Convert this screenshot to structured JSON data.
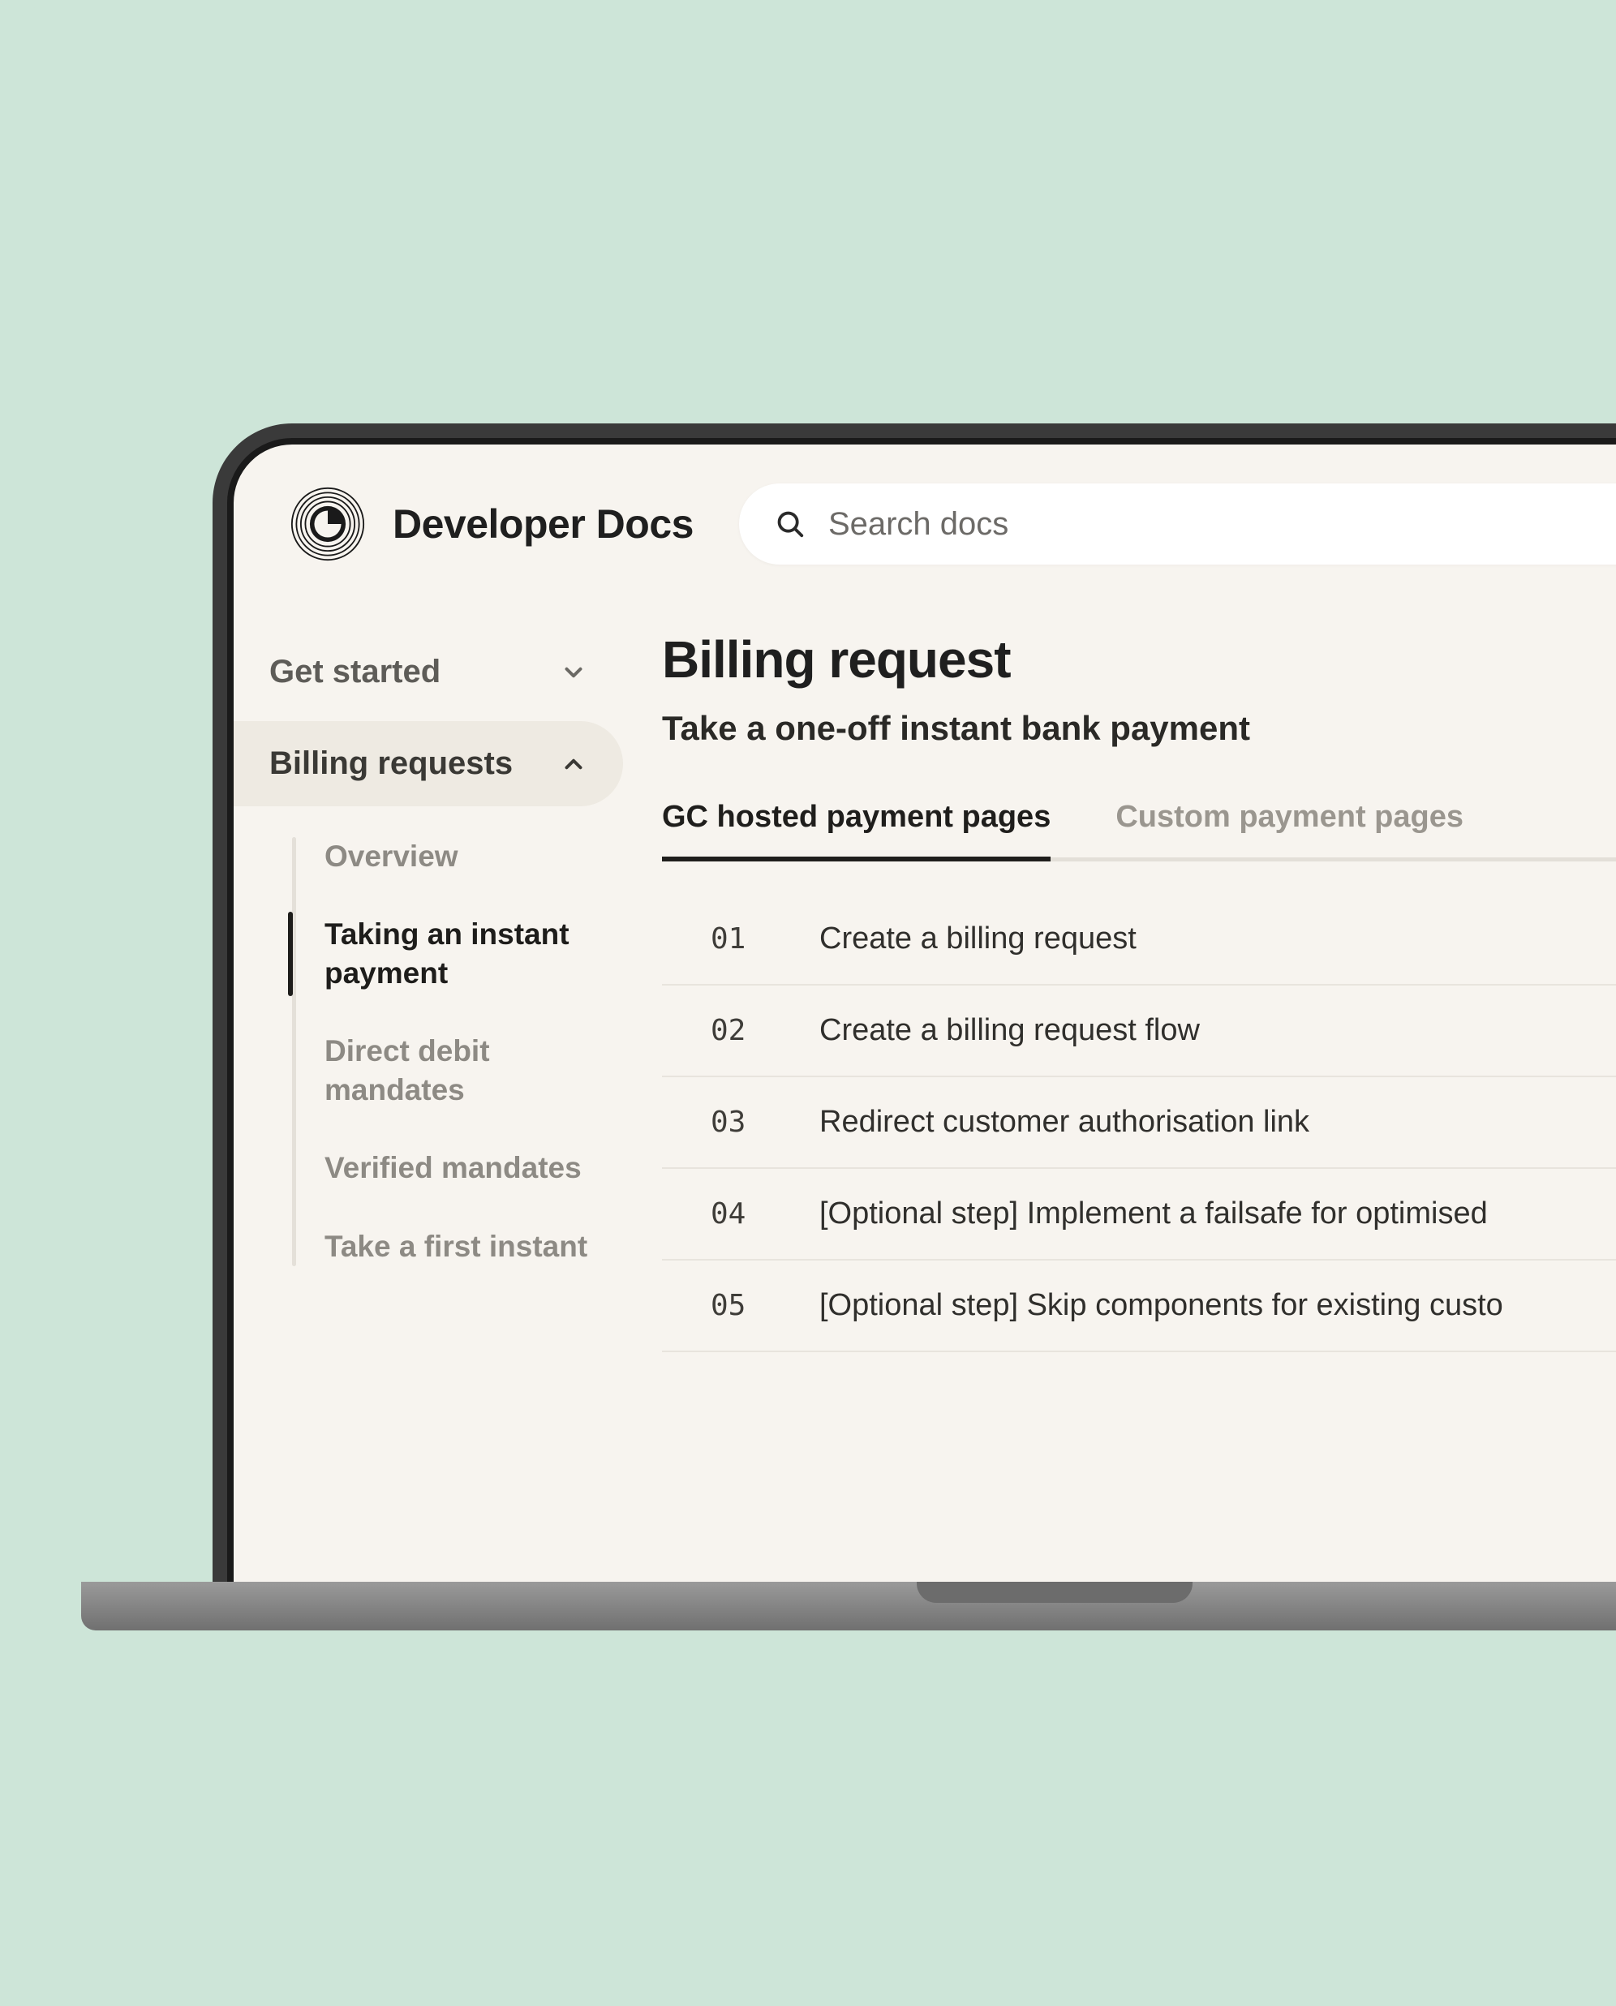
{
  "header": {
    "brand": "Developer Docs",
    "search_placeholder": "Search docs"
  },
  "sidebar": {
    "top": [
      {
        "label": "Get started",
        "expanded": false
      },
      {
        "label": "Billing requests",
        "expanded": true
      }
    ],
    "sub": [
      {
        "label": "Overview",
        "active": false
      },
      {
        "label": "Taking an instant payment",
        "active": true
      },
      {
        "label": "Direct debit mandates",
        "active": false
      },
      {
        "label": "Verified mandates",
        "active": false
      },
      {
        "label": "Take a first instant",
        "active": false
      }
    ]
  },
  "main": {
    "title": "Billing request",
    "subtitle": "Take a one-off instant bank payment",
    "tabs": [
      {
        "label": "GC hosted payment pages",
        "active": true
      },
      {
        "label": "Custom payment pages",
        "active": false
      }
    ],
    "steps": [
      {
        "num": "01",
        "label": "Create a billing request"
      },
      {
        "num": "02",
        "label": "Create a billing request flow"
      },
      {
        "num": "03",
        "label": "Redirect customer authorisation link"
      },
      {
        "num": "04",
        "label": "[Optional step] Implement a failsafe for optimised"
      },
      {
        "num": "05",
        "label": "[Optional step] Skip components for existing custo"
      }
    ]
  }
}
